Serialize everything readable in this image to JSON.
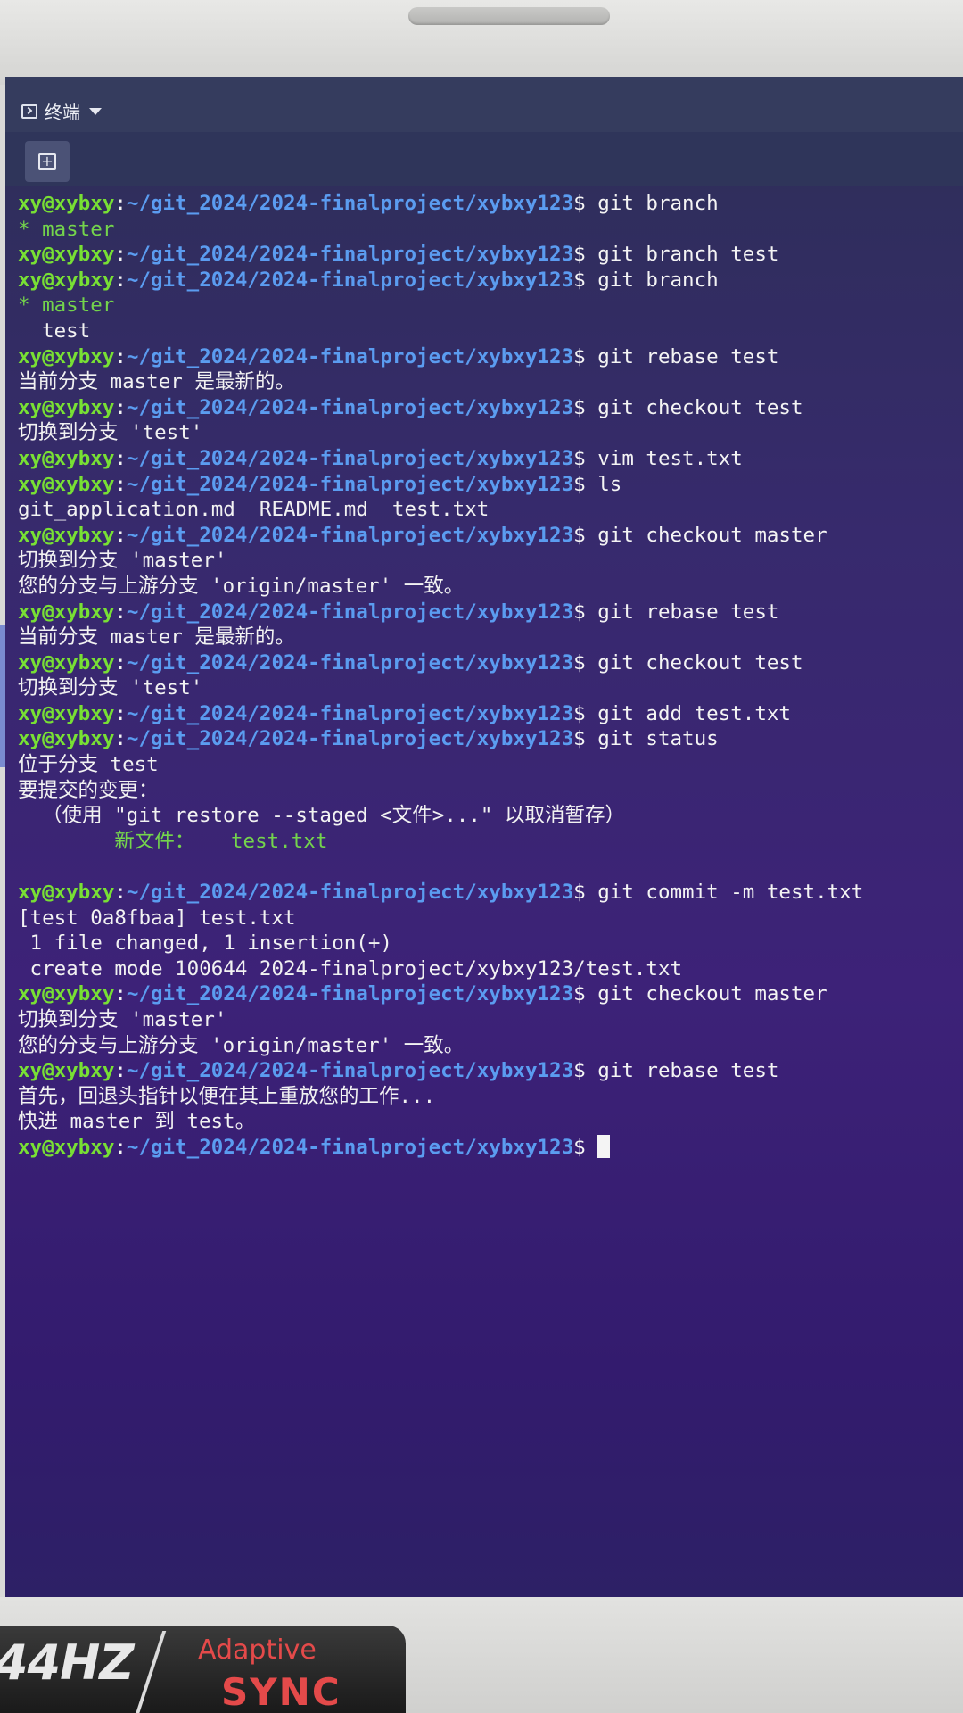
{
  "panel": {
    "app_title": "终端"
  },
  "prompt": {
    "user": "xy@xybxy",
    "path": "~/git_2024/2024-finalproject/xybxy123",
    "symbol": "$"
  },
  "terminal_lines": [
    {
      "type": "prompt",
      "cmd": "git branch"
    },
    {
      "type": "out",
      "text": "* master",
      "color": "green"
    },
    {
      "type": "prompt",
      "cmd": "git branch test"
    },
    {
      "type": "prompt",
      "cmd": "git branch"
    },
    {
      "type": "out",
      "text": "* master",
      "color": "green"
    },
    {
      "type": "out",
      "text": "  test"
    },
    {
      "type": "prompt",
      "cmd": "git rebase test"
    },
    {
      "type": "out",
      "text": "当前分支 master 是最新的。"
    },
    {
      "type": "prompt",
      "cmd": "git checkout test"
    },
    {
      "type": "out",
      "text": "切换到分支 'test'"
    },
    {
      "type": "prompt",
      "cmd": "vim test.txt"
    },
    {
      "type": "prompt",
      "cmd": "ls"
    },
    {
      "type": "out",
      "text": "git_application.md  README.md  test.txt"
    },
    {
      "type": "prompt",
      "cmd": "git checkout master"
    },
    {
      "type": "out",
      "text": "切换到分支 'master'"
    },
    {
      "type": "out",
      "text": "您的分支与上游分支 'origin/master' 一致。"
    },
    {
      "type": "prompt",
      "cmd": "git rebase test"
    },
    {
      "type": "out",
      "text": "当前分支 master 是最新的。"
    },
    {
      "type": "prompt",
      "cmd": "git checkout test"
    },
    {
      "type": "out",
      "text": "切换到分支 'test'"
    },
    {
      "type": "prompt",
      "cmd": "git add test.txt"
    },
    {
      "type": "prompt",
      "cmd": "git status"
    },
    {
      "type": "out",
      "text": "位于分支 test"
    },
    {
      "type": "out",
      "text": "要提交的变更："
    },
    {
      "type": "out",
      "text": "  （使用 \"git restore --staged <文件>...\" 以取消暂存）"
    },
    {
      "type": "out",
      "text": "\t新文件：   test.txt",
      "color": "green"
    },
    {
      "type": "out",
      "text": ""
    },
    {
      "type": "prompt",
      "cmd": "git commit -m test.txt"
    },
    {
      "type": "out",
      "text": "[test 0a8fbaa] test.txt"
    },
    {
      "type": "out",
      "text": " 1 file changed, 1 insertion(+)"
    },
    {
      "type": "out",
      "text": " create mode 100644 2024-finalproject/xybxy123/test.txt"
    },
    {
      "type": "prompt",
      "cmd": "git checkout master"
    },
    {
      "type": "out",
      "text": "切换到分支 'master'"
    },
    {
      "type": "out",
      "text": "您的分支与上游分支 'origin/master' 一致。"
    },
    {
      "type": "prompt",
      "cmd": "git rebase test"
    },
    {
      "type": "out",
      "text": "首先，回退头指针以便在其上重放您的工作..."
    },
    {
      "type": "out",
      "text": "快进 master 到 test。"
    },
    {
      "type": "prompt",
      "cmd": "",
      "cursor": true
    }
  ],
  "monitor_badge": {
    "refresh": "44HZ",
    "adaptive": "Adaptive",
    "sync": "SYNC"
  },
  "colors": {
    "user": "#78e034",
    "path": "#5b9cf0",
    "green_text": "#74d44c",
    "background": "#3d2278",
    "panel": "#353c5e"
  },
  "icons": {
    "panel_app": "terminal-icon",
    "panel_menu": "chevron-down-icon",
    "new_tab": "new-tab-icon"
  }
}
